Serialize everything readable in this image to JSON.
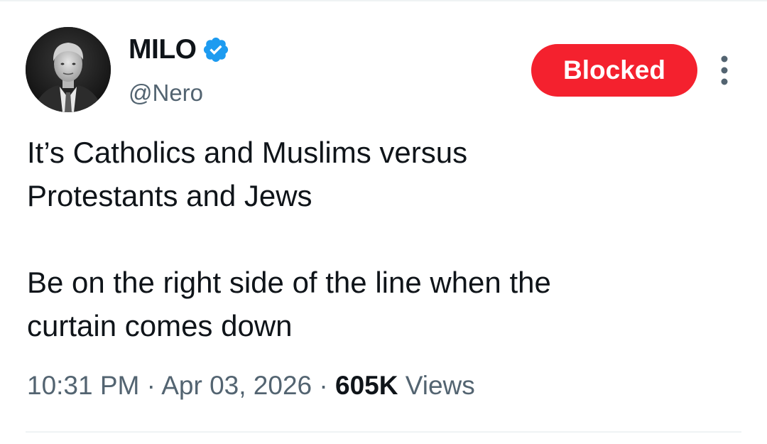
{
  "author": {
    "display_name": "MILO",
    "handle": "@Nero",
    "verified": true
  },
  "actions": {
    "blocked_label": "Blocked",
    "more_icon": "more-vertical-icon"
  },
  "tweet": {
    "line1": "It’s Catholics and Muslims versus",
    "line2": "Protestants and Jews",
    "line3": "Be on the right side of the line when the",
    "line4": "curtain comes down"
  },
  "meta": {
    "time": "10:31 PM",
    "separator": "·",
    "date": "Apr 03, 2026",
    "views_count": "605K",
    "views_label": "Views"
  },
  "colors": {
    "blocked_bg": "#f4212e",
    "verified_blue": "#1d9bf0",
    "secondary_text": "#536471",
    "primary_text": "#0f1419"
  }
}
